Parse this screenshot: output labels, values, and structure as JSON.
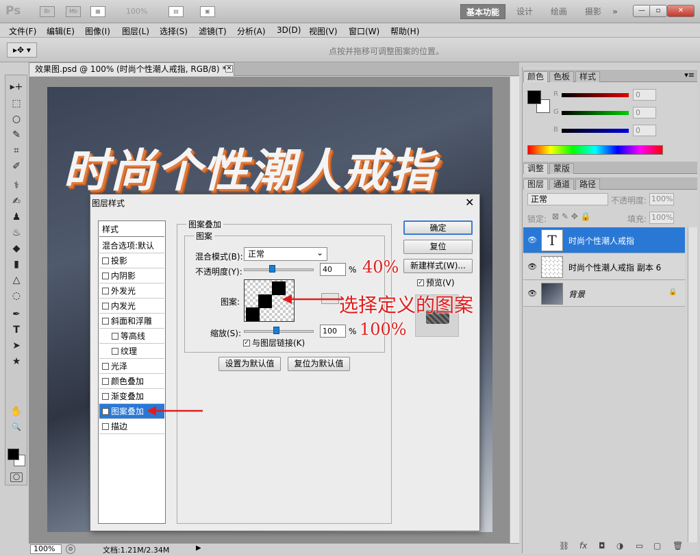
{
  "app": {
    "logo": "Ps",
    "ic_br": "Br",
    "ic_mb": "Mb",
    "zoom": "100%",
    "workspaces": [
      "基本功能",
      "设计",
      "绘画",
      "摄影"
    ],
    "more": "»",
    "win_min": "—",
    "win_max": "▫",
    "win_close": "✕"
  },
  "menu": [
    "文件(F)",
    "编辑(E)",
    "图像(I)",
    "图层(L)",
    "选择(S)",
    "滤镜(T)",
    "分析(A)",
    "3D(D)",
    "视图(V)",
    "窗口(W)",
    "帮助(H)"
  ],
  "options": {
    "hint": "点按并拖移可调整图案的位置。"
  },
  "document": {
    "tab": "效果图.psd @ 100% (时尚个性潮人戒指, RGB/8) *",
    "close": "✕",
    "headline": "时尚个性潮人戒指",
    "zoom": "100%",
    "docinfo": "文档:1.21M/2.34M",
    "play": "▶"
  },
  "tools": [
    "▸+",
    "⬚",
    "○",
    "✎",
    "⌗",
    "✐",
    "⚕",
    "✍",
    "♟",
    "♨",
    "◆",
    "▮",
    "△",
    "◌",
    "✒",
    "T",
    "➤",
    "★",
    "✋",
    "🔍"
  ],
  "panels": {
    "color_tabs": [
      "颜色",
      "色板",
      "样式"
    ],
    "color_labels": [
      "R",
      "G",
      "B"
    ],
    "color_values": [
      "0",
      "0",
      "0"
    ],
    "adjust_tabs": [
      "调整",
      "蒙版"
    ],
    "layer_tabs": [
      "图层",
      "通道",
      "路径"
    ],
    "blend_mode": "正常",
    "opacity_label": "不透明度:",
    "opacity_value": "100%",
    "lock_label": "锁定:",
    "fill_label": "填充:",
    "fill_value": "100%",
    "layers": [
      {
        "name": "时尚个性潮人戒指",
        "thumb": "T",
        "selected": true
      },
      {
        "name": "时尚个性潮人戒指 副本 6",
        "thumb": ""
      },
      {
        "name": "背景",
        "thumb": ""
      }
    ],
    "bottom_icons": [
      "⛓",
      "fx",
      "◘",
      "◑",
      "▭",
      "▢",
      "🗑"
    ]
  },
  "dialog": {
    "title": "图层样式",
    "close": "✕",
    "list_header": "样式",
    "list_first": "混合选项:默认",
    "items": [
      {
        "label": "投影",
        "checked": false,
        "indent": false
      },
      {
        "label": "内阴影",
        "checked": false,
        "indent": false
      },
      {
        "label": "外发光",
        "checked": false,
        "indent": false
      },
      {
        "label": "内发光",
        "checked": false,
        "indent": false
      },
      {
        "label": "斜面和浮雕",
        "checked": false,
        "indent": false
      },
      {
        "label": "等高线",
        "checked": false,
        "indent": true
      },
      {
        "label": "纹理",
        "checked": false,
        "indent": true
      },
      {
        "label": "光泽",
        "checked": false,
        "indent": false
      },
      {
        "label": "颜色叠加",
        "checked": false,
        "indent": false
      },
      {
        "label": "渐变叠加",
        "checked": false,
        "indent": false
      },
      {
        "label": "图案叠加",
        "checked": true,
        "indent": false,
        "selected": true
      },
      {
        "label": "描边",
        "checked": false,
        "indent": false
      }
    ],
    "group_title": "图案叠加",
    "sub_group": "图案",
    "blend_label": "混合模式(B):",
    "blend_value": "正常",
    "blend_arrow": "⌄",
    "opacity_label": "不透明度(Y):",
    "opacity_value": "40",
    "opacity_fraction": 0.4,
    "percent": "%",
    "pattern_label": "图案:",
    "scale_label": "缩放(S):",
    "scale_value": "100",
    "scale_fraction": 0.46,
    "link_label": "与图层链接(K)",
    "link_checked": true,
    "btn_default": "设置为默认值",
    "btn_reset_default": "复位为默认值",
    "btn_ok": "确定",
    "btn_reset": "复位",
    "btn_new_style": "新建样式(W)...",
    "preview_label": "预览(V)"
  },
  "annotations": {
    "opacity_note": "40%",
    "pattern_note": "选择定义的图案",
    "scale_note": "100%"
  },
  "colors": {
    "accent": "#2a78d6",
    "annotation": "#e01d1d",
    "headline_shadow": "#e07a3c"
  }
}
